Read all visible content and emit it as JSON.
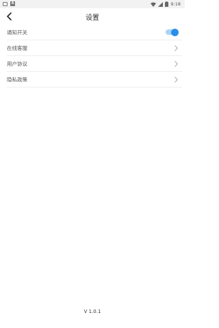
{
  "status_bar": {
    "time": "9:18"
  },
  "header": {
    "title": "设置"
  },
  "settings": {
    "items": [
      {
        "label": "通知开关",
        "control": "toggle",
        "checked": true
      },
      {
        "label": "在线客服",
        "control": "chevron"
      },
      {
        "label": "用户协议",
        "control": "chevron"
      },
      {
        "label": "隐私政策",
        "control": "chevron"
      }
    ]
  },
  "footer": {
    "version": "V 1.0.1"
  },
  "colors": {
    "toggle_on": "#2b8fe8",
    "toggle_track": "#a9d4f7",
    "divider": "#eeeeee"
  }
}
